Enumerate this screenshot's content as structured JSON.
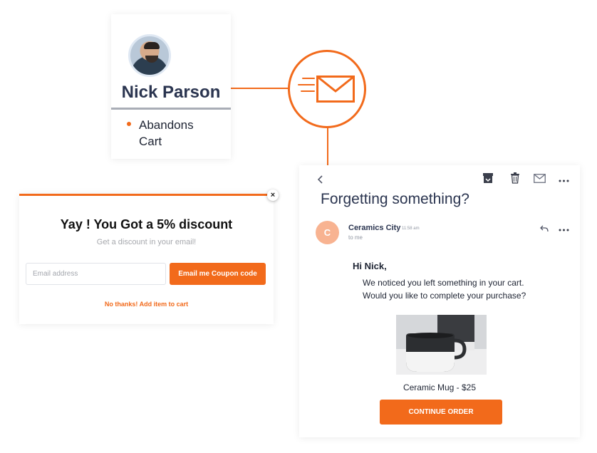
{
  "profile": {
    "name": "Nick Parson",
    "event": "Abandons Cart"
  },
  "popup": {
    "close_label": "×",
    "title": "Yay ! You Got a 5% discount",
    "subtitle": "Get a discount in your email!",
    "email_placeholder": "Email address",
    "coupon_button": "Email me Coupon code",
    "no_thanks": "No thanks! Add item to cart"
  },
  "email": {
    "subject": "Forgetting something?",
    "sender_initial": "C",
    "sender_name": "Ceramics City",
    "time": "11:58 am",
    "to": "to me",
    "greeting": "Hi Nick,",
    "body_line_1": "We noticed you left something in your cart.",
    "body_line_2": "Would you like to complete your purchase?",
    "product_caption": "Ceramic Mug - $25",
    "cta": "CONTINUE ORDER"
  },
  "colors": {
    "accent": "#f26a1b",
    "heading": "#2b3550"
  },
  "icons": [
    "mail-icon",
    "back-icon",
    "archive-icon",
    "trash-icon",
    "envelope-icon",
    "more-icon",
    "reply-icon",
    "close-icon"
  ]
}
